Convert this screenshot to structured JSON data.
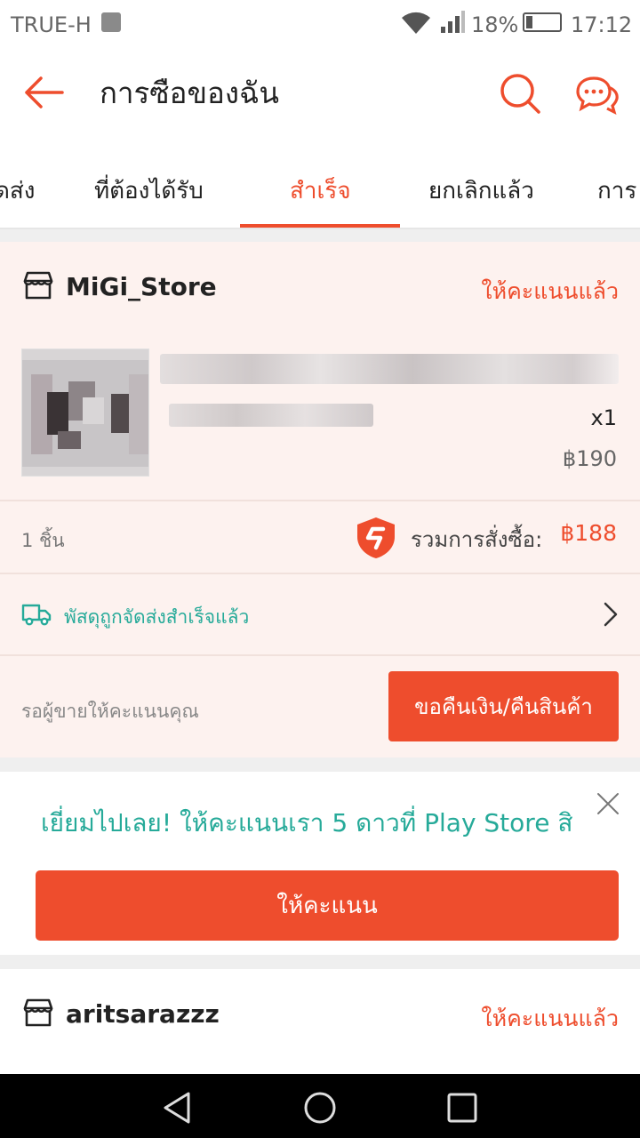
{
  "status_bar": {
    "carrier": "TRUE-H",
    "battery": "18%",
    "time": "17:12"
  },
  "header": {
    "title": "การซือของฉัน"
  },
  "tabs": [
    {
      "label": "ดส่ง"
    },
    {
      "label": "ที่ต้องได้รับ"
    },
    {
      "label": "สำเร็จ"
    },
    {
      "label": "ยกเลิกแล้ว"
    },
    {
      "label": "การ"
    }
  ],
  "orders": [
    {
      "shop_name": "MiGi_Store",
      "rating_status": "ให้คะแนนแล้ว",
      "quantity": "x1",
      "price": "฿190",
      "item_count": "1 ชิ้น",
      "total_label": "รวมการสั่งซื้อ:",
      "total_value": "฿188",
      "shipping_status": "พัสดุถูกจัดส่งสำเร็จแล้ว",
      "waiting_text": "รอผู้ขายให้คะแนนคุณ",
      "action_button": "ขอคืนเงิน/คืนสินค้า"
    },
    {
      "shop_name": "aritsarazzz",
      "rating_status": "ให้คะแนนแล้ว"
    }
  ],
  "promo": {
    "message": "เยี่ยมไปเลย! ให้คะแนนเรา 5 ดาวที่ Play Store สิ",
    "button": "ให้คะแนน"
  },
  "colors": {
    "accent": "#ee4d2d",
    "teal": "#26aa99"
  }
}
